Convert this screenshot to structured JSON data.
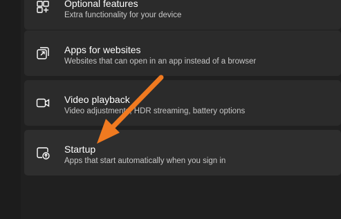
{
  "settings_list": {
    "items": [
      {
        "title": "Optional features",
        "subtitle": "Extra functionality for your device",
        "icon": "optional-features-icon"
      },
      {
        "title": "Apps for websites",
        "subtitle": "Websites that can open in an app instead of a browser",
        "icon": "apps-for-websites-icon"
      },
      {
        "title": "Video playback",
        "subtitle": "Video adjustments, HDR streaming, battery options",
        "icon": "video-playback-icon"
      },
      {
        "title": "Startup",
        "subtitle": "Apps that start automatically when you sign in",
        "icon": "startup-icon"
      }
    ]
  },
  "annotation": {
    "arrow_color": "#f07a20",
    "points_to": "Startup"
  }
}
